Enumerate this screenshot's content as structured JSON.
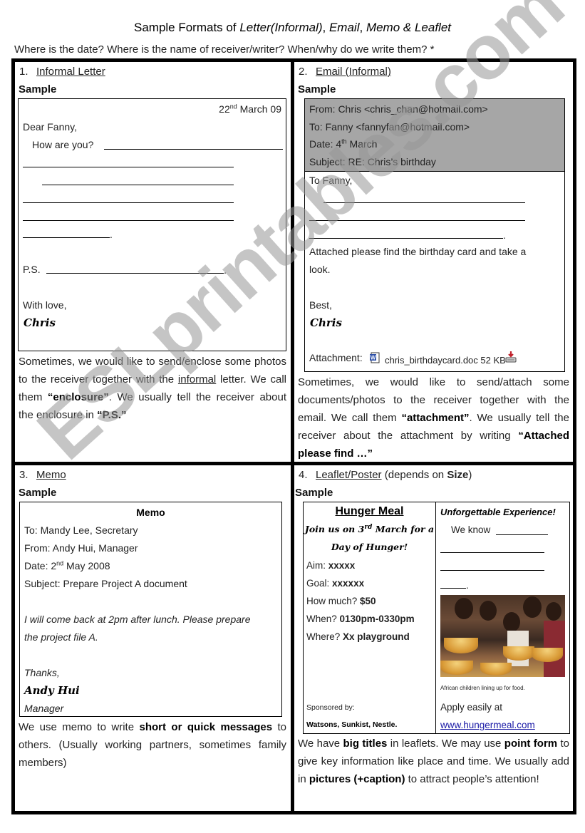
{
  "page": {
    "title_prefix": "Sample Formats of ",
    "title_letter": "Letter(Informal)",
    "title_sep1": ", ",
    "title_email": "Email",
    "title_sep2": ", ",
    "title_memo": "Memo & Leaflet",
    "question": "Where is the date? Where is the name of receiver/writer? When/why do we write them? *",
    "watermark": "ESLprintables.com"
  },
  "sections": {
    "letter": {
      "number": "1.",
      "heading": "Informal Letter",
      "sample_label": "Sample",
      "date_day": "22",
      "date_suffix": "nd",
      "date_rest": " March 09",
      "greeting": "Dear Fanny,",
      "opening": "How are you?",
      "ps_label": "P.S.",
      "closing": "With love,",
      "signature": "Chris",
      "explain_1": "Sometimes, we would like to send/enclose some photos to the receiver together with the ",
      "explain_informal": "informal",
      "explain_2": " letter. We call them ",
      "explain_enclosure": "“enclosure”",
      "explain_3": ". We usually tell the receiver about the enclosure in ",
      "explain_ps": "“P.S.”"
    },
    "email": {
      "number": "2.",
      "heading": "Email (Informal)",
      "sample_label": "Sample",
      "from": "From: Chris <chris_chan@hotmail.com>",
      "to": "To: Fanny <fannyfan@hotmail.com>",
      "date_prefix": "Date: 4",
      "date_suffix": "th",
      "date_rest": " March",
      "subject": "Subject: RE: Chris’s birthday",
      "greeting": "To Fanny,",
      "body_line1": "Attached please find the birthday card and take a",
      "body_line2": "look.",
      "closing": "Best,",
      "signature": "Chris",
      "attachment_label": "Attachment:",
      "attachment_file": "chris_birthdaycard.doc",
      "attachment_size": "52 KB",
      "explain_1": "Sometimes, we would like to send/attach some documents/photos to the receiver together with the email. We call them ",
      "explain_attachment": "“attachment”",
      "explain_2": ". We usually tell the receiver about the attachment by writing ",
      "explain_attached": "“Attached please find …”"
    },
    "memo": {
      "number": "3.",
      "heading": "Memo",
      "sample_label": "Sample",
      "memo_title": "Memo",
      "to": "To: Mandy Lee, Secretary",
      "from": "From: Andy Hui, Manager",
      "date_prefix": "Date: 2",
      "date_suffix": "nd",
      "date_rest": " May 2008",
      "subject": "Subject: Prepare Project A document",
      "body_line1": "I will come back at 2pm after lunch. Please prepare",
      "body_line2": "the project file A.",
      "closing": "Thanks,",
      "signature": "Andy Hui",
      "role": "Manager",
      "explain_1": "We use memo to write ",
      "explain_bold": "short or quick messages",
      "explain_2": " to others. (Usually working partners, sometimes family members)"
    },
    "leaflet": {
      "number": "4.",
      "heading": "Leaflet/Poster",
      "heading_rest": " (depends on ",
      "heading_size": "Size",
      "heading_close": ")",
      "sample_label": "Sample",
      "left": {
        "title": "Hunger Meal",
        "tagline_1a": "Join us on 3",
        "tagline_1sup": "rd",
        "tagline_1b": " March for a",
        "tagline_2": "Day of Hunger!",
        "aim_label": "Aim: ",
        "aim_value": "xxxxx",
        "goal_label": "Goal: ",
        "goal_value": "xxxxxx",
        "price_label": "How much? ",
        "price_value": "$50",
        "when_label": "When? ",
        "when_value": "0130pm-0330pm",
        "where_label": "Where? ",
        "where_value": "Xx playground",
        "sponsor_label": "Sponsored by:",
        "sponsors": "Watsons, Sunkist, Nestle."
      },
      "right": {
        "title": "Unforgettable Experience!",
        "we_know": "We know",
        "caption": "African children lining up for food.",
        "apply": "Apply easily at",
        "url": "www.hungermeal.com"
      },
      "explain_1": "We have ",
      "explain_big": "big titles",
      "explain_2": " in leaflets. We may use ",
      "explain_point": "point form",
      "explain_3": " to give key information like place and time. We usually add in ",
      "explain_pictures": "pictures (+caption)",
      "explain_4": " to attract people’s attention!"
    }
  },
  "icons": {
    "word_doc": "word-document-icon",
    "download": "download-icon"
  }
}
